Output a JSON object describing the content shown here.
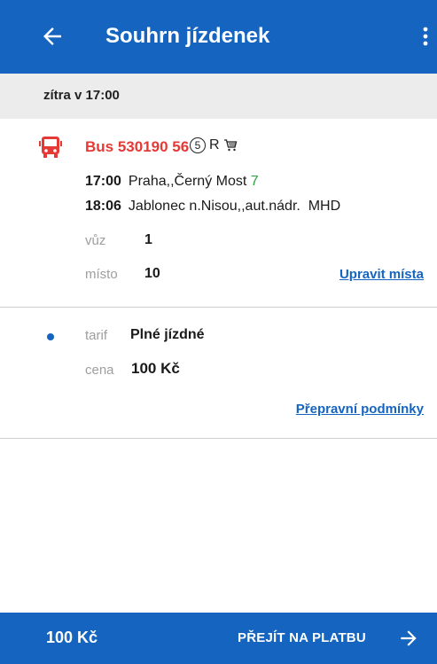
{
  "header": {
    "title": "Souhrn jízdenek",
    "back_icon": "arrow-left-icon",
    "menu_icon": "more-vertical-icon"
  },
  "day": {
    "label": "zítra v 17:00"
  },
  "connection": {
    "icon": "bus-icon",
    "name": "Bus 530190 56",
    "badge_circle": "5",
    "badge_letter": "R",
    "badge_icon": "cart-icon",
    "departure": {
      "time": "17:00",
      "stop": "Praha,,Černý Most",
      "platform": "7"
    },
    "arrival": {
      "time": "18:06",
      "stop": "Jablonec n.Nisou,,aut.nádr.  MHD"
    },
    "car_label": "vůz",
    "car_value": "1",
    "seat_label": "místo",
    "seat_value": "10",
    "edit_seats_link": "Upravit místa"
  },
  "tariff": {
    "tarif_label": "tarif",
    "tarif_value": "Plné jízdné",
    "price_label": "cena",
    "price_value": "100 Kč",
    "conditions_link": "Přepravní podmínky"
  },
  "footer": {
    "total": "100 Kč",
    "pay_label": "PŘEJÍT NA PLATBU",
    "pay_icon": "arrow-right-icon"
  },
  "colors": {
    "primary": "#1565c0",
    "bus_red": "#e53935",
    "platform_green": "#2ea043",
    "day_bg": "#ececec"
  }
}
